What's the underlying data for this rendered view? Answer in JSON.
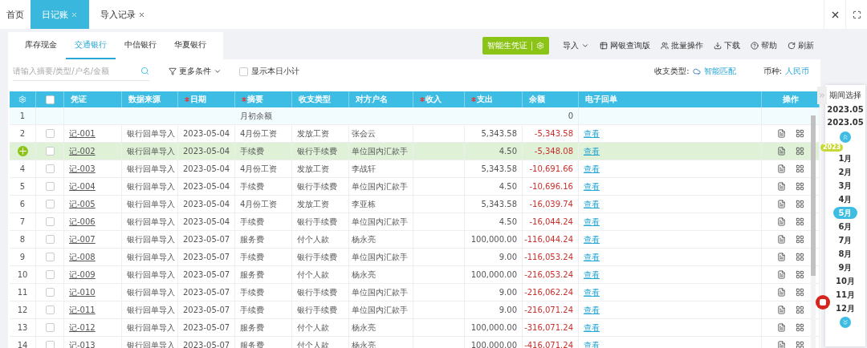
{
  "top_tabs": [
    {
      "label": "首页",
      "selected": false,
      "closable": false
    },
    {
      "label": "日记账",
      "selected": true,
      "closable": true
    },
    {
      "label": "导入记录",
      "selected": false,
      "closable": true
    }
  ],
  "account_tabs": [
    {
      "label": "库存现金",
      "selected": false
    },
    {
      "label": "交通银行",
      "selected": true
    },
    {
      "label": "中信银行",
      "selected": false
    },
    {
      "label": "华夏银行",
      "selected": false
    }
  ],
  "toolbar": {
    "primary": "智能生凭证",
    "actions": [
      {
        "kind": "dropdown",
        "label": "导入"
      },
      {
        "kind": "table",
        "label": "网银查询版"
      },
      {
        "kind": "batch",
        "label": "批量操作"
      },
      {
        "kind": "download",
        "label": "下载"
      },
      {
        "kind": "help",
        "label": "帮助"
      },
      {
        "kind": "refresh",
        "label": "刷新"
      }
    ]
  },
  "filters": {
    "search": {
      "placeholder": "请输入摘要/类型/户名/金额"
    },
    "more": "更多条件",
    "daily_subtotal": {
      "label": "显示本日小计",
      "checked": false
    },
    "type_label": "收支类型:",
    "type_value": "智能匹配",
    "currency_label": "币种:",
    "currency_value": "人民币"
  },
  "table": {
    "select_all": {
      "checked": false
    },
    "columns": [
      {
        "label": "凭证",
        "required": false
      },
      {
        "label": "数据来源",
        "required": false
      },
      {
        "label": "日期",
        "required": true
      },
      {
        "label": "摘要",
        "required": true
      },
      {
        "label": "收支类型",
        "required": false
      },
      {
        "label": "对方户名",
        "required": false
      },
      {
        "label": "收入",
        "required": true
      },
      {
        "label": "支出",
        "required": true
      },
      {
        "label": "余额",
        "required": false
      },
      {
        "label": "电子回单",
        "required": false
      },
      {
        "label": "操作",
        "required": false
      }
    ],
    "rows": [
      {
        "kind": "opening",
        "no": "1",
        "summary": "月初余额",
        "balance": "0"
      },
      {
        "kind": "entry",
        "no": "2",
        "selected": false,
        "checked": false,
        "voucher": "记-001",
        "source": "银行回单导入",
        "date": "2023-05-04",
        "summary": "4月份工资",
        "type": "发放工资",
        "counterparty": "张会云",
        "expense": "5,343.58",
        "balance": "-5,343.58",
        "receipt": "查看"
      },
      {
        "kind": "entry",
        "selected": true,
        "checked": false,
        "voucher": "记-002",
        "source": "银行回单导入",
        "date": "2023-05-04",
        "summary": "手续费",
        "type": "银行手续费",
        "counterparty": "单位国内汇款手",
        "expense": "4.50",
        "balance": "-5,348.08",
        "receipt": "查看"
      },
      {
        "kind": "entry",
        "no": "4",
        "selected": false,
        "checked": false,
        "voucher": "记-003",
        "source": "银行回单导入",
        "date": "2023-05-04",
        "summary": "4月份工资",
        "type": "发放工资",
        "counterparty": "李战轩",
        "expense": "5,343.58",
        "balance": "-10,691.66",
        "receipt": "查看"
      },
      {
        "kind": "entry",
        "no": "5",
        "selected": false,
        "checked": false,
        "voucher": "记-004",
        "source": "银行回单导入",
        "date": "2023-05-04",
        "summary": "手续费",
        "type": "银行手续费",
        "counterparty": "单位国内汇款手",
        "expense": "4.50",
        "balance": "-10,696.16",
        "receipt": "查看"
      },
      {
        "kind": "entry",
        "no": "6",
        "selected": false,
        "checked": false,
        "voucher": "记-005",
        "source": "银行回单导入",
        "date": "2023-05-04",
        "summary": "4月份工资",
        "type": "发放工资",
        "counterparty": "李亚栋",
        "expense": "5,343.58",
        "balance": "-16,039.74",
        "receipt": "查看"
      },
      {
        "kind": "entry",
        "no": "7",
        "selected": false,
        "checked": false,
        "voucher": "记-006",
        "source": "银行回单导入",
        "date": "2023-05-04",
        "summary": "手续费",
        "type": "银行手续费",
        "counterparty": "单位国内汇款手",
        "expense": "4.50",
        "balance": "-16,044.24",
        "receipt": "查看"
      },
      {
        "kind": "entry",
        "no": "8",
        "selected": false,
        "checked": false,
        "voucher": "记-007",
        "source": "银行回单导入",
        "date": "2023-05-07",
        "summary": "服务费",
        "type": "付个人款",
        "counterparty": "杨永亮",
        "expense": "100,000.00",
        "balance": "-116,044.24",
        "receipt": "查看"
      },
      {
        "kind": "entry",
        "no": "9",
        "selected": false,
        "checked": false,
        "voucher": "记-008",
        "source": "银行回单导入",
        "date": "2023-05-07",
        "summary": "手续费",
        "type": "银行手续费",
        "counterparty": "单位国内汇款手",
        "expense": "9.00",
        "balance": "-116,053.24",
        "receipt": "查看"
      },
      {
        "kind": "entry",
        "no": "10",
        "selected": false,
        "checked": false,
        "voucher": "记-009",
        "source": "银行回单导入",
        "date": "2023-05-07",
        "summary": "服务费",
        "type": "付个人款",
        "counterparty": "杨永亮",
        "expense": "100,000.00",
        "balance": "-216,053.24",
        "receipt": "查看"
      },
      {
        "kind": "entry",
        "no": "11",
        "selected": false,
        "checked": false,
        "voucher": "记-010",
        "source": "银行回单导入",
        "date": "2023-05-07",
        "summary": "手续费",
        "type": "银行手续费",
        "counterparty": "单位国内汇款手",
        "expense": "9.00",
        "balance": "-216,062.24",
        "receipt": "查看"
      },
      {
        "kind": "entry",
        "no": "12",
        "selected": false,
        "checked": false,
        "voucher": "记-011",
        "source": "银行回单导入",
        "date": "2023-05-07",
        "summary": "手续费",
        "type": "银行手续费",
        "counterparty": "单位国内汇款手",
        "expense": "9.00",
        "balance": "-216,071.24",
        "receipt": "查看"
      },
      {
        "kind": "entry",
        "no": "13",
        "selected": false,
        "checked": false,
        "voucher": "记-012",
        "source": "银行回单导入",
        "date": "2023-05-07",
        "summary": "服务费",
        "type": "付个人款",
        "counterparty": "杨永亮",
        "expense": "100,000.00",
        "balance": "-316,071.24",
        "receipt": "查看"
      },
      {
        "kind": "entry",
        "no": "14",
        "selected": false,
        "checked": false,
        "voucher": "记-013",
        "source": "银行回单导入",
        "date": "2023-05-07",
        "summary": "服务费",
        "type": "付个人款",
        "counterparty": "杨永亮",
        "expense": "100,000.00",
        "balance": "-416,071.24",
        "receipt": "查看"
      }
    ]
  },
  "period": {
    "title": "期间选择",
    "start": "2023.05",
    "end": "2023.05",
    "year": "2023",
    "months": [
      {
        "label": "1月",
        "selected": false
      },
      {
        "label": "2月",
        "selected": false
      },
      {
        "label": "3月",
        "selected": false
      },
      {
        "label": "4月",
        "selected": false
      },
      {
        "label": "5月",
        "selected": true
      },
      {
        "label": "6月",
        "selected": false
      },
      {
        "label": "7月",
        "selected": false
      },
      {
        "label": "8月",
        "selected": false
      },
      {
        "label": "9月",
        "selected": false
      },
      {
        "label": "10月",
        "selected": false
      },
      {
        "label": "11月",
        "selected": false
      },
      {
        "label": "12月",
        "selected": false
      }
    ]
  }
}
